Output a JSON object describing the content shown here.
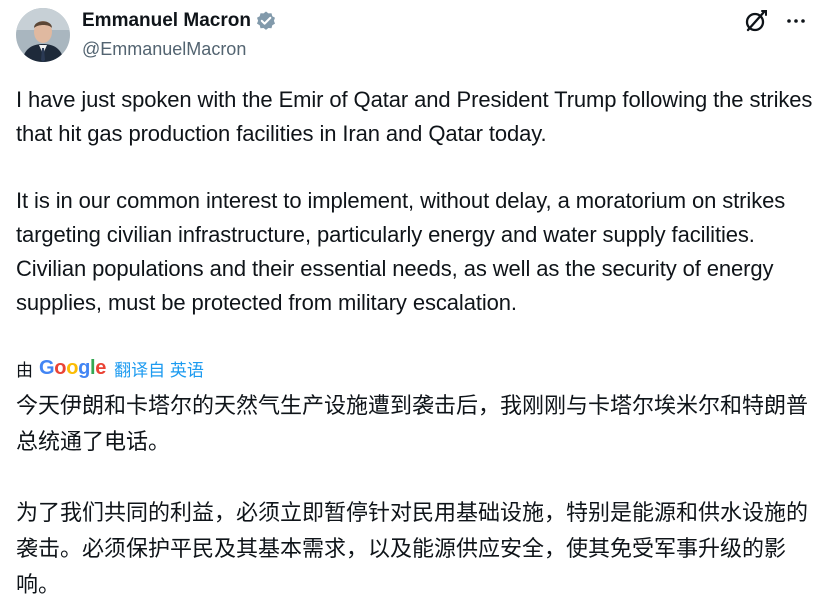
{
  "author": {
    "display_name": "Emmanuel Macron",
    "handle": "@EmmanuelMacron",
    "verified_color": "#829aab"
  },
  "icons": {
    "grok": "grok-icon",
    "more": "more-horizontal-icon",
    "verified": "verified-badge-icon"
  },
  "tweet": {
    "paragraph_1": "I have just spoken with the Emir of Qatar and President Trump following the strikes that hit gas production facilities in Iran and Qatar today.",
    "paragraph_2": "It is in our common interest to implement, without delay, a moratorium on strikes targeting civilian infrastructure, particularly energy and water supply facilities. Civilian populations and their essential needs, as well as the security of energy supplies, must be protected from military escalation."
  },
  "translation": {
    "prefix": "由",
    "provider": "Google",
    "link_text": "翻译自 英语",
    "paragraph_1": "今天伊朗和卡塔尔的天然气生产设施遭到袭击后，我刚刚与卡塔尔埃米尔和特朗普总统通了电话。",
    "paragraph_2": "为了我们共同的利益，必须立即暂停针对民用基础设施，特别是能源和供水设施的袭击。必须保护平民及其基本需求，以及能源供应安全，使其免受军事升级的影响。"
  },
  "colors": {
    "text": "#0f1419",
    "secondary": "#536471",
    "link": "#1d9bf0"
  }
}
